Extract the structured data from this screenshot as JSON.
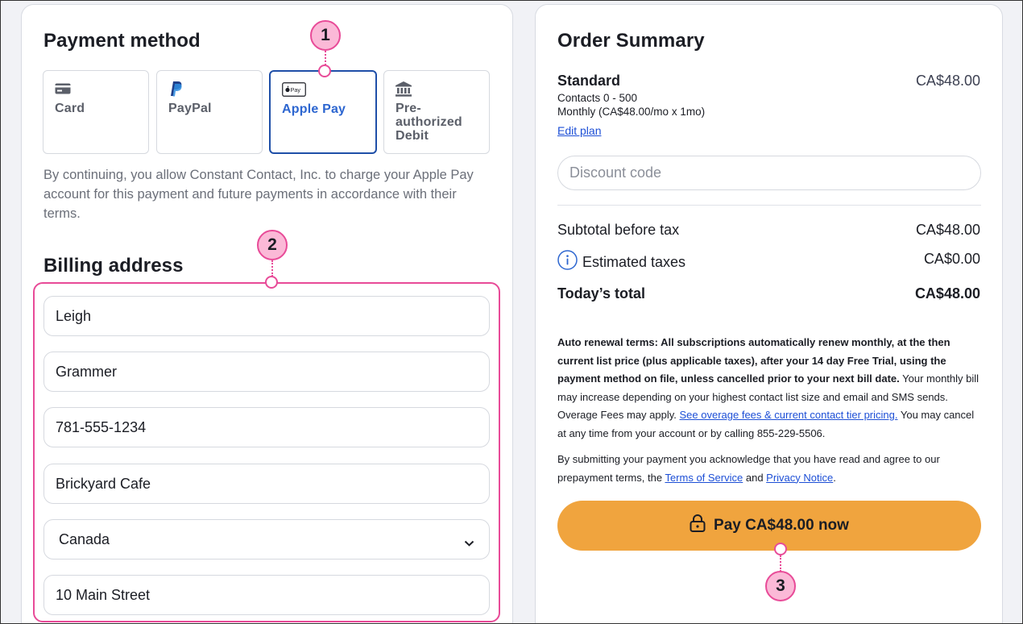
{
  "payment": {
    "title": "Payment method",
    "options": [
      {
        "label": "Card",
        "icon": "credit-card-icon"
      },
      {
        "label": "PayPal",
        "icon": "paypal-icon"
      },
      {
        "label": "Apple Pay",
        "icon": "apple-pay-icon",
        "selected": true
      },
      {
        "label": "Pre-authorized Debit",
        "icon": "bank-icon"
      }
    ],
    "apple_pay_icon_text": "Pay",
    "terms": "By continuing, you allow Constant Contact, Inc. to charge your Apple Pay account for this payment and future payments in accordance with their terms."
  },
  "billing": {
    "title": "Billing address",
    "first_name": "Leigh",
    "last_name": "Grammer",
    "phone": "781-555-1234",
    "company": "Brickyard Cafe",
    "country": "Canada",
    "street": "10 Main Street"
  },
  "annotations": [
    "1",
    "2",
    "3"
  ],
  "summary": {
    "title": "Order Summary",
    "plan_name": "Standard",
    "plan_price": "CA$48.00",
    "plan_contacts": "Contacts 0 - 500",
    "plan_billing": "Monthly (CA$48.00/mo x 1mo)",
    "edit_plan": "Edit plan",
    "discount_placeholder": "Discount code",
    "subtotal_label": "Subtotal before tax",
    "subtotal_value": "CA$48.00",
    "taxes_label": "Estimated taxes",
    "taxes_value": "CA$0.00",
    "total_label": "Today’s total",
    "total_value": "CA$48.00",
    "auto_renew_bold": "Auto renewal terms: All subscriptions automatically renew monthly, at the then current list price (plus applicable taxes), after your 14 day Free Trial, using the payment method on file, unless cancelled prior to your next bill date.",
    "auto_renew_rest": " Your monthly bill may increase depending on your highest contact list size and email and SMS sends. Overage Fees may apply. ",
    "overage_link": "See overage fees & current contact tier pricing.",
    "cancel_text": " You may cancel at any time from your account or by calling 855-229-5506.",
    "ack_text": "By submitting your payment you acknowledge that you have read and agree to our prepayment terms, the ",
    "tos_link": "Terms of Service",
    "and_text": " and ",
    "privacy_link": "Privacy Notice",
    "period": ".",
    "pay_button": "Pay CA$48.00 now"
  },
  "colors": {
    "accent_pink": "#e84b98",
    "pay_orange": "#f0a43e",
    "selected_blue": "#1f4fa8",
    "link_blue": "#1d4fd6"
  }
}
